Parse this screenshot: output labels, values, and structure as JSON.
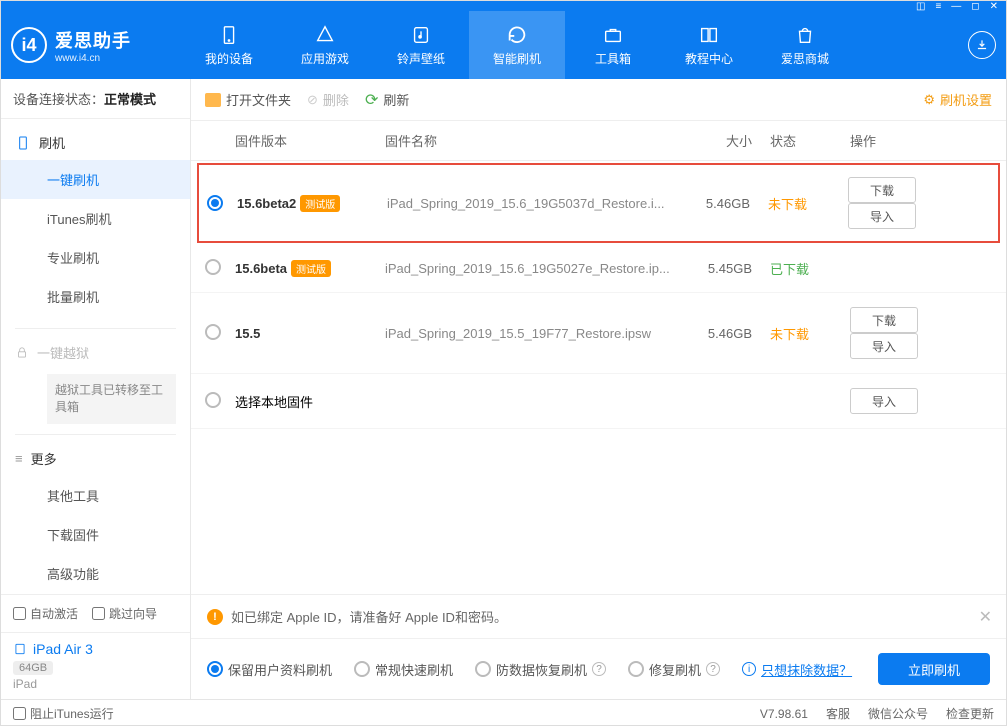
{
  "titlebar_icons": [
    "⬚",
    "≡",
    "—",
    "◻",
    "✕"
  ],
  "logo": {
    "title": "爱思助手",
    "sub": "www.i4.cn",
    "mark": "i4"
  },
  "nav": [
    {
      "label": "我的设备"
    },
    {
      "label": "应用游戏"
    },
    {
      "label": "铃声壁纸"
    },
    {
      "label": "智能刷机",
      "active": true
    },
    {
      "label": "工具箱"
    },
    {
      "label": "教程中心"
    },
    {
      "label": "爱思商城"
    }
  ],
  "sidebar": {
    "conn_label": "设备连接状态：",
    "conn_value": "正常模式",
    "flash_head": "刷机",
    "items": [
      "一键刷机",
      "iTunes刷机",
      "专业刷机",
      "批量刷机"
    ],
    "jailbreak_head": "一键越狱",
    "jailbreak_note": "越狱工具已转移至工具箱",
    "more_head": "更多",
    "more_items": [
      "其他工具",
      "下载固件",
      "高级功能"
    ],
    "auto_activate": "自动激活",
    "skip_guide": "跳过向导",
    "device_name": "iPad Air 3",
    "device_storage": "64GB",
    "device_type": "iPad"
  },
  "toolbar": {
    "open": "打开文件夹",
    "delete": "删除",
    "refresh": "刷新",
    "settings": "刷机设置"
  },
  "columns": {
    "ver": "固件版本",
    "name": "固件名称",
    "size": "大小",
    "status": "状态",
    "ops": "操作"
  },
  "rows": [
    {
      "selected": true,
      "highlighted": true,
      "ver": "15.6beta2",
      "beta": "测试版",
      "name": "iPad_Spring_2019_15.6_19G5037d_Restore.i...",
      "size": "5.46GB",
      "status": "未下载",
      "status_class": "orange",
      "download": true,
      "import": true
    },
    {
      "selected": false,
      "ver": "15.6beta",
      "beta": "测试版",
      "name": "iPad_Spring_2019_15.6_19G5027e_Restore.ip...",
      "size": "5.45GB",
      "status": "已下载",
      "status_class": "green"
    },
    {
      "selected": false,
      "ver": "15.5",
      "name": "iPad_Spring_2019_15.5_19F77_Restore.ipsw",
      "size": "5.46GB",
      "status": "未下载",
      "status_class": "orange",
      "download": true,
      "import": true
    },
    {
      "selected": false,
      "local": true,
      "ver_text": "选择本地固件",
      "import": true
    }
  ],
  "buttons": {
    "download": "下载",
    "import": "导入"
  },
  "alert": "如已绑定 Apple ID，请准备好 Apple ID和密码。",
  "options": [
    {
      "label": "保留用户资料刷机",
      "sel": true
    },
    {
      "label": "常规快速刷机"
    },
    {
      "label": "防数据恢复刷机",
      "help": true
    },
    {
      "label": "修复刷机",
      "help": true
    }
  ],
  "erase_link": "只想抹除数据？",
  "flash_now": "立即刷机",
  "status": {
    "block_itunes": "阻止iTunes运行",
    "version": "V7.98.61",
    "custservice": "客服",
    "wechat": "微信公众号",
    "update": "检查更新"
  }
}
